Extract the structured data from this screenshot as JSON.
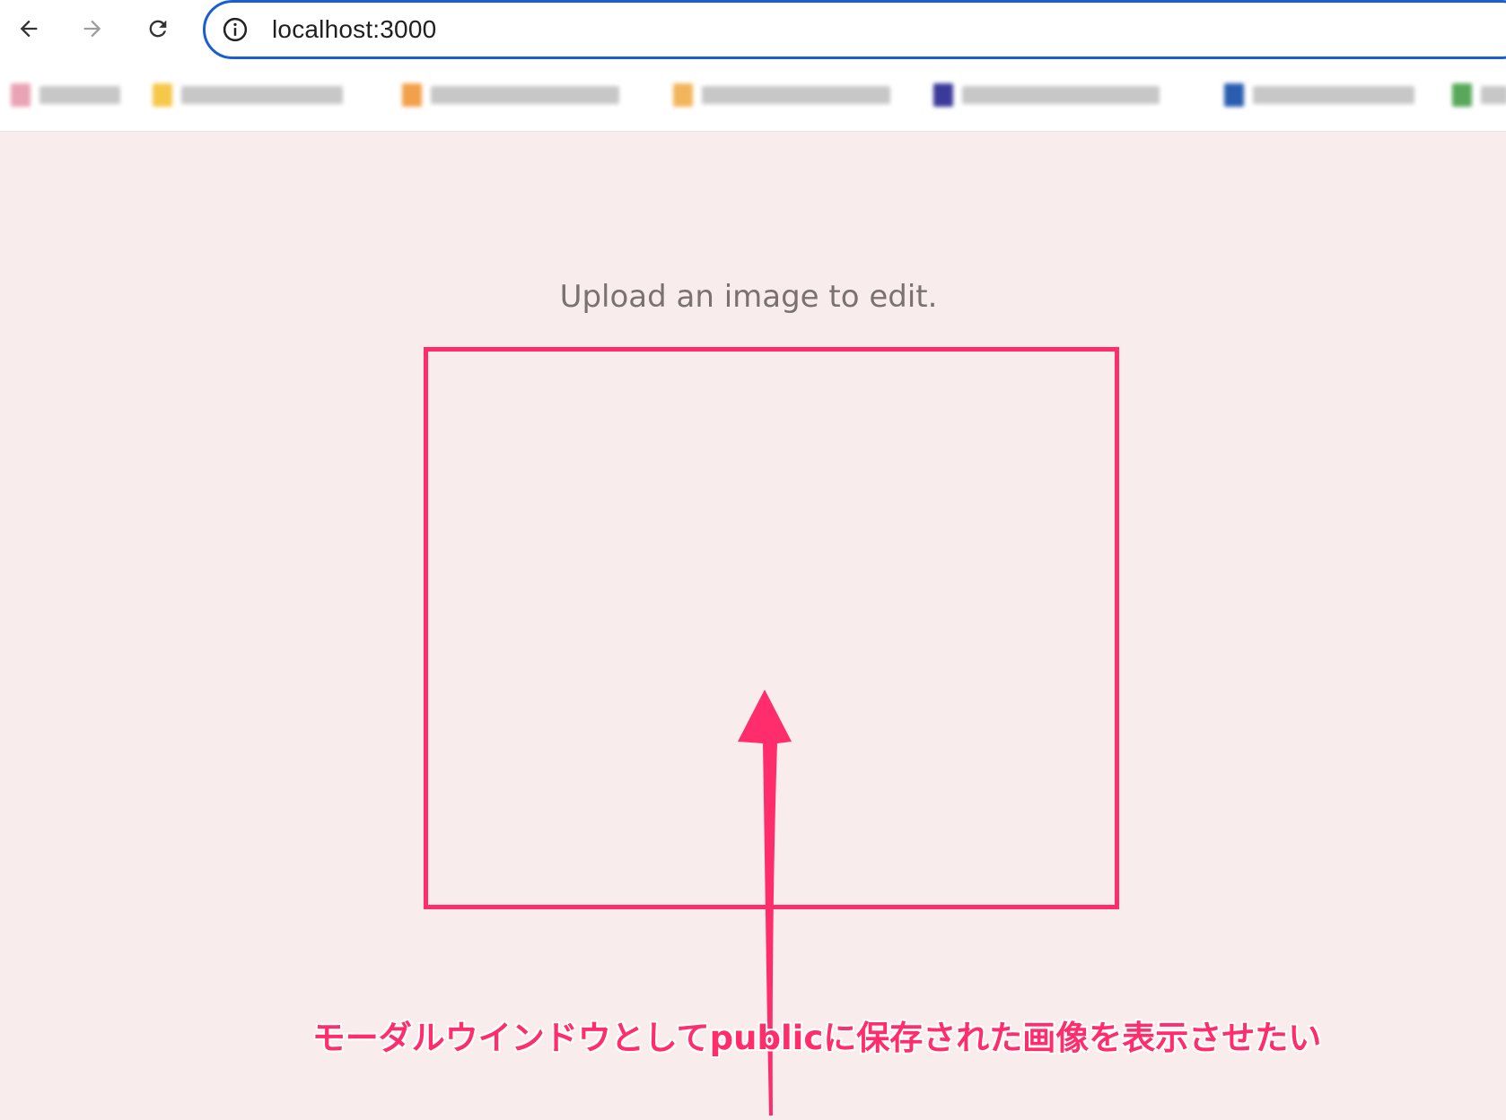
{
  "browser": {
    "url": "localhost:3000",
    "bookmarks": [
      {
        "favicon_color": "#e9a3b5",
        "text_width": 90
      },
      {
        "favicon_color": "#f5c84a",
        "text_width": 180
      },
      {
        "favicon_color": "#f2a04a",
        "text_width": 210
      },
      {
        "favicon_color": "#f3b55b",
        "text_width": 210
      },
      {
        "favicon_color": "#3b3a9a",
        "text_width": 220
      },
      {
        "favicon_color": "#2a5db0",
        "text_width": 180
      },
      {
        "favicon_color": "#58a85a",
        "text_width": 40
      }
    ]
  },
  "page": {
    "prompt": "Upload an image to edit."
  },
  "annotation": {
    "text": "モーダルウインドウとしてpublicに保存された画像を表示させたい",
    "color": "#ff2d6c"
  }
}
